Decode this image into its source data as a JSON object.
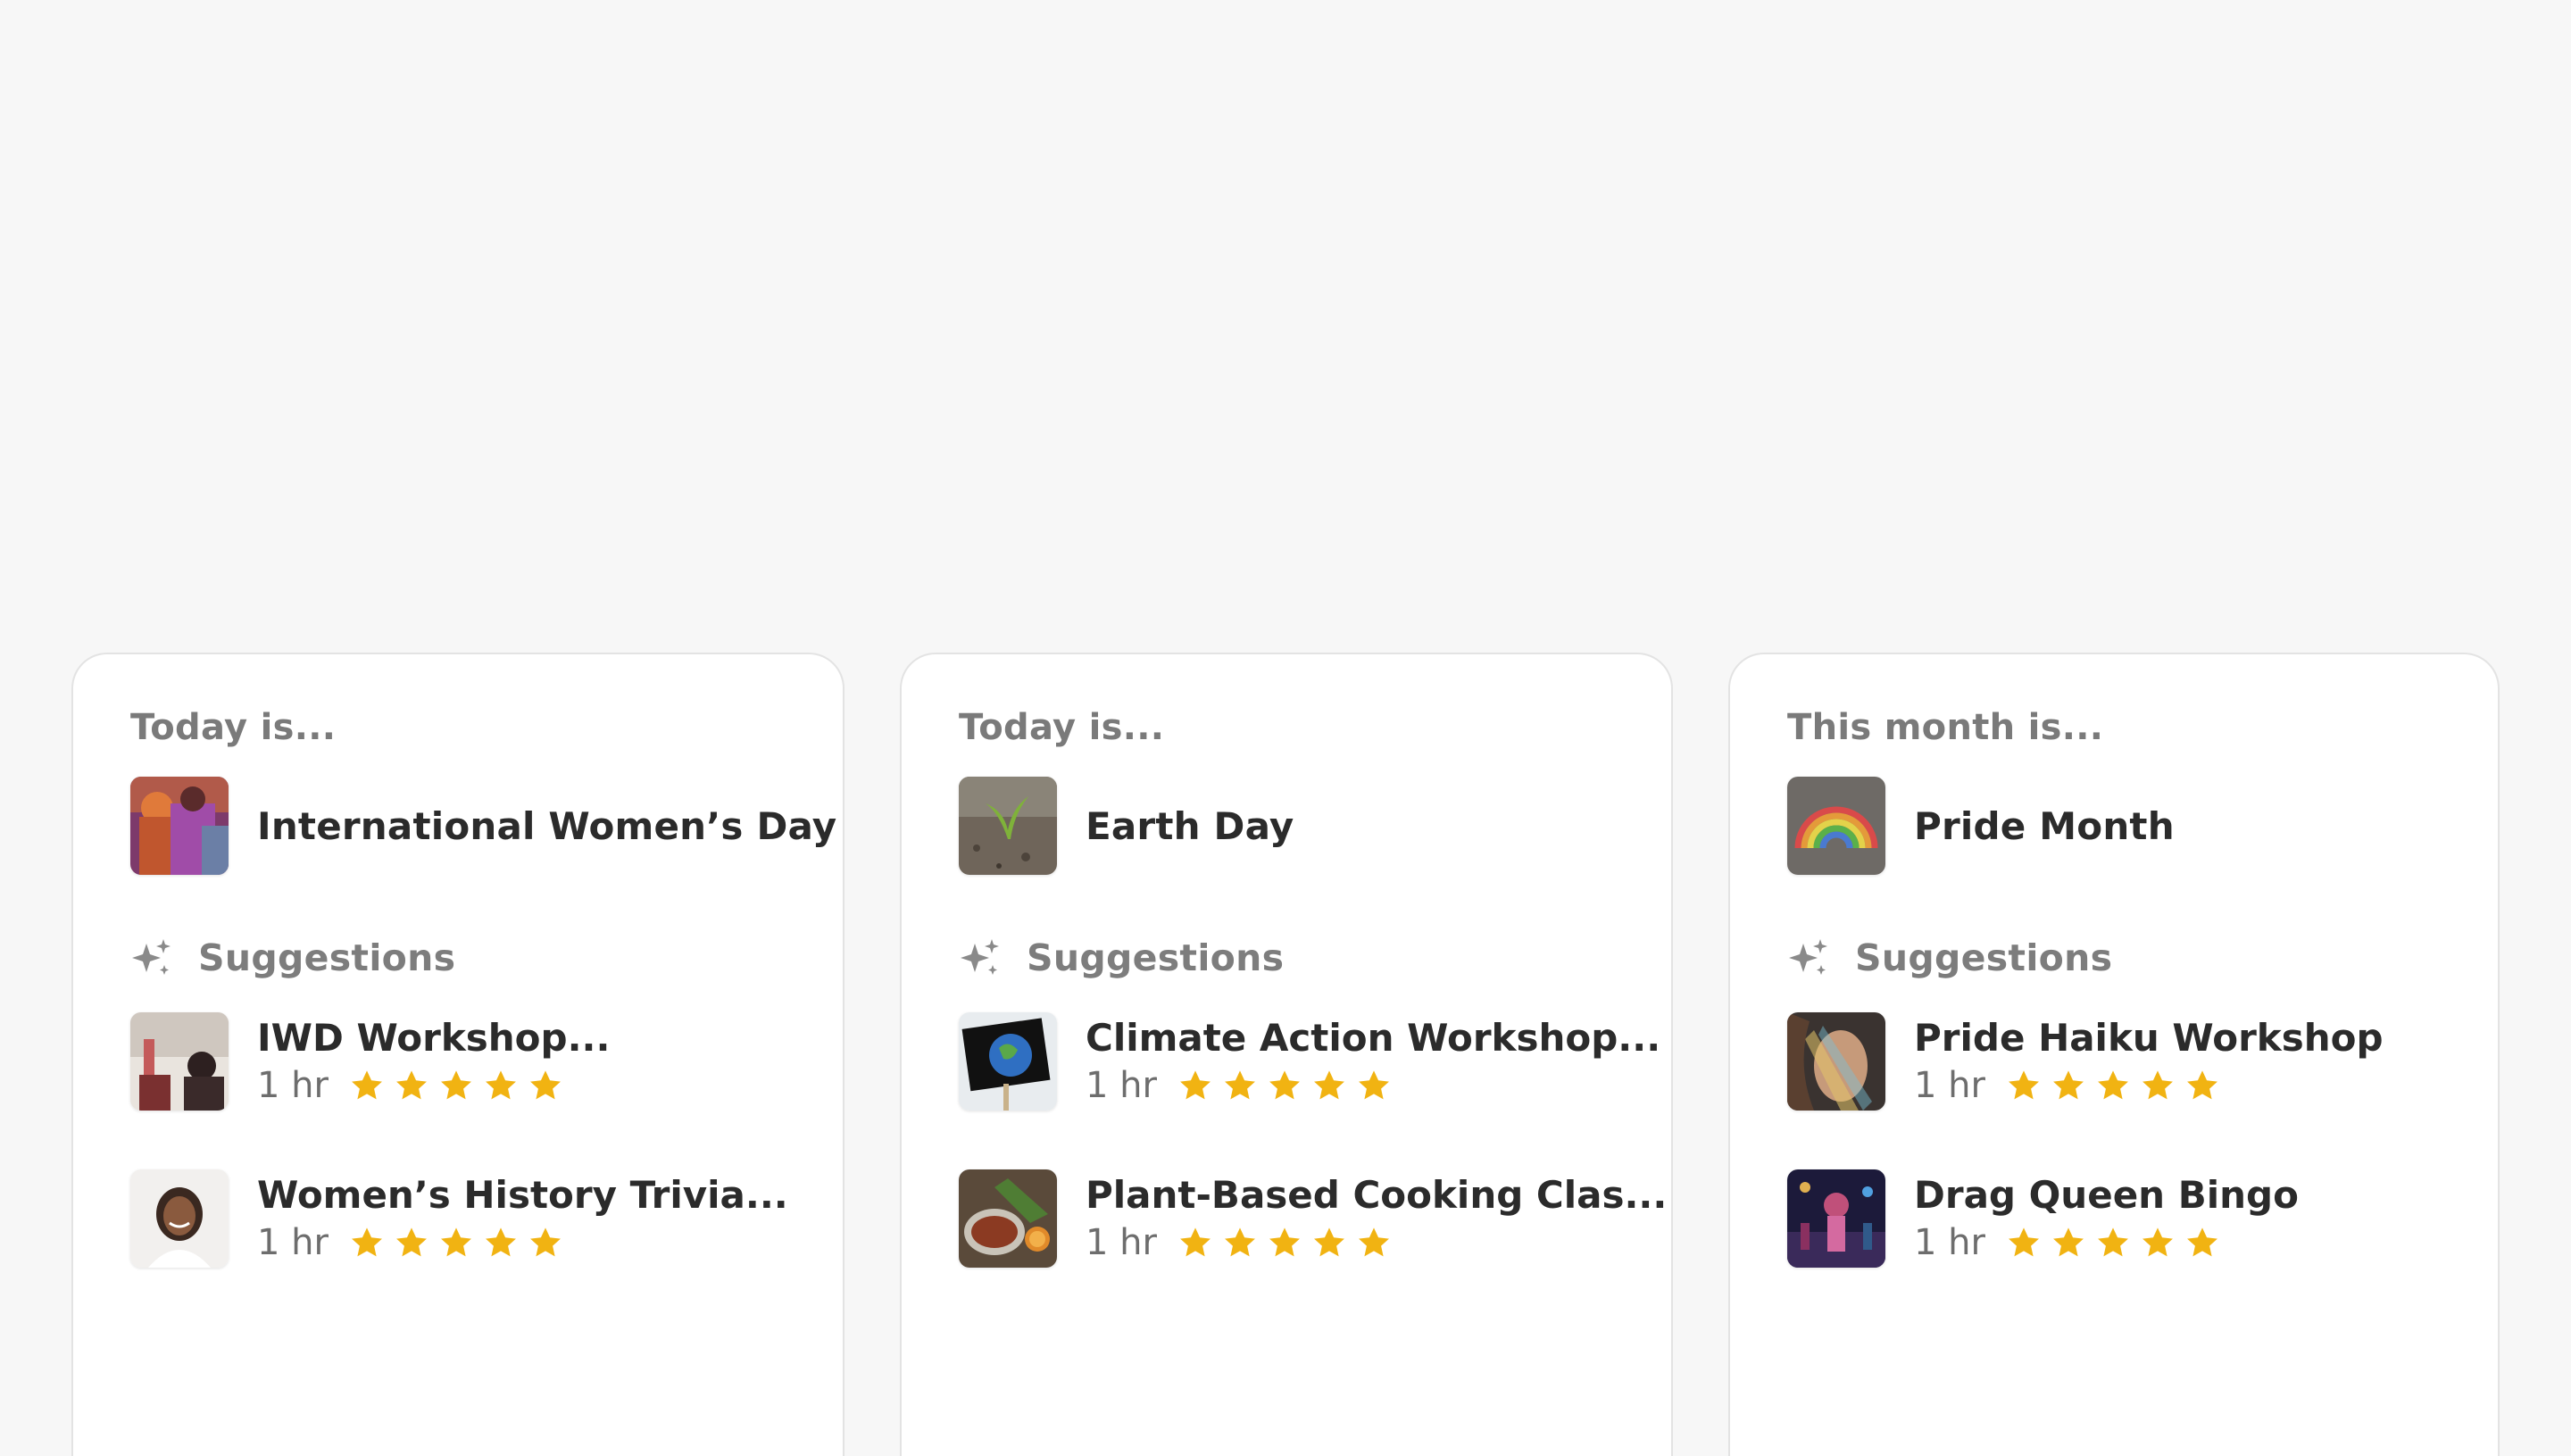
{
  "colors": {
    "background": "#f7f7f7",
    "card": "#ffffff",
    "star": "#f1b312",
    "heading_text": "#7a7a7a",
    "primary_text": "#2b2b2b"
  },
  "cards": [
    {
      "heading": "Today is...",
      "event": {
        "name": "International Women’s Day",
        "image": "women-group-photo"
      },
      "suggestions_label": "Suggestions",
      "suggestions": [
        {
          "title": "IWD Workshop...",
          "duration": "1 hr",
          "rating": 5,
          "image": "raised-hand-photo"
        },
        {
          "title": "Women’s History Trivia...",
          "duration": "1 hr",
          "rating": 5,
          "image": "smiling-woman-photo"
        }
      ]
    },
    {
      "heading": "Today is...",
      "event": {
        "name": "Earth Day",
        "image": "seedling-photo"
      },
      "suggestions_label": "Suggestions",
      "suggestions": [
        {
          "title": "Climate Action Workshop...",
          "duration": "1 hr",
          "rating": 5,
          "image": "one-world-sign-photo"
        },
        {
          "title": "Plant-Based Cooking Clas...",
          "duration": "1 hr",
          "rating": 5,
          "image": "food-bowls-photo"
        }
      ]
    },
    {
      "heading": "This month is...",
      "event": {
        "name": "Pride Month",
        "image": "chalk-rainbow-photo"
      },
      "suggestions_label": "Suggestions",
      "suggestions": [
        {
          "title": "Pride Haiku Workshop",
          "duration": "1 hr",
          "rating": 5,
          "image": "rainbow-light-face-photo"
        },
        {
          "title": "Drag Queen Bingo",
          "duration": "1 hr",
          "rating": 5,
          "image": "stage-performance-photo"
        }
      ]
    }
  ]
}
